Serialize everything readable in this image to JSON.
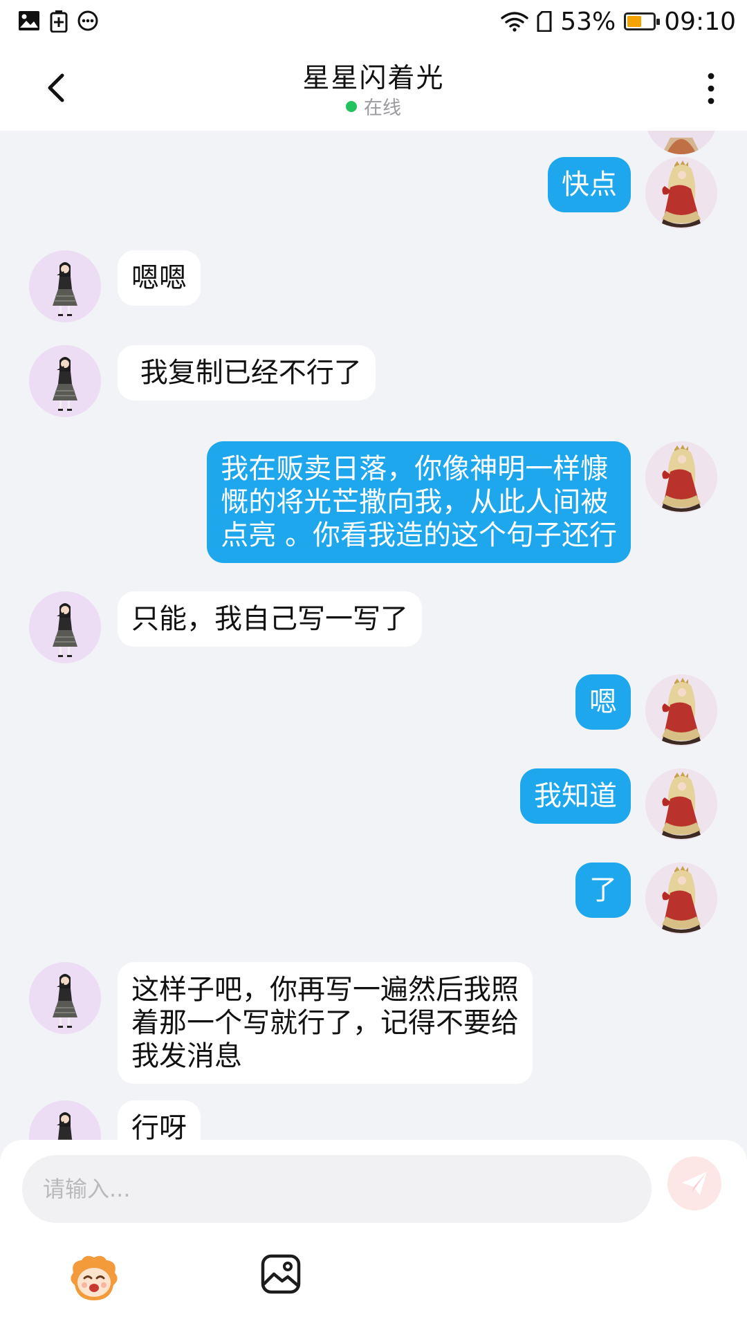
{
  "status_bar": {
    "left_icons": [
      "image-icon",
      "battery-plus-icon",
      "more-circle-icon"
    ],
    "wifi_icon": "wifi-icon",
    "sim_icon": "sim-card-icon",
    "battery_percent": "53%",
    "battery_level": 0.53,
    "battery_color": "#f5a300",
    "time": "09:10"
  },
  "header": {
    "back_icon": "chevron-left-icon",
    "title": "星星闪着光",
    "presence": "在线",
    "presence_color": "#22c35e",
    "more_icon": "more-vertical-icon"
  },
  "colors": {
    "outgoing_bubble": "#1ea7ec",
    "incoming_bubble": "#ffffff",
    "background": "#f2f3f6"
  },
  "messages": [
    {
      "side": "out",
      "lines": [
        "快点"
      ]
    },
    {
      "side": "in",
      "lines": [
        "嗯嗯"
      ]
    },
    {
      "side": "in",
      "lines": [
        " 我复制已经不行了"
      ]
    },
    {
      "side": "out",
      "lines": [
        "我在贩卖日落，你像神明一样慷",
        "慨的将光芒撒向我，从此人间被",
        "点亮 。你看我造的这个句子还行"
      ]
    },
    {
      "side": "in",
      "lines": [
        "只能，我自己写一写了"
      ]
    },
    {
      "side": "out",
      "lines": [
        "嗯"
      ]
    },
    {
      "side": "out",
      "lines": [
        "我知道"
      ]
    },
    {
      "side": "out",
      "lines": [
        "了"
      ]
    },
    {
      "side": "in",
      "lines": [
        "这样子吧，你再写一遍然后我照",
        "着那一个写就行了，记得不要给",
        "我发消息"
      ]
    },
    {
      "side": "in",
      "lines": [
        "行呀"
      ]
    }
  ],
  "composer": {
    "placeholder": "请输入...",
    "value": "",
    "send_icon": "send-icon",
    "emoji_icon": "emoji-sticker-icon",
    "image_icon": "image-picker-icon"
  }
}
